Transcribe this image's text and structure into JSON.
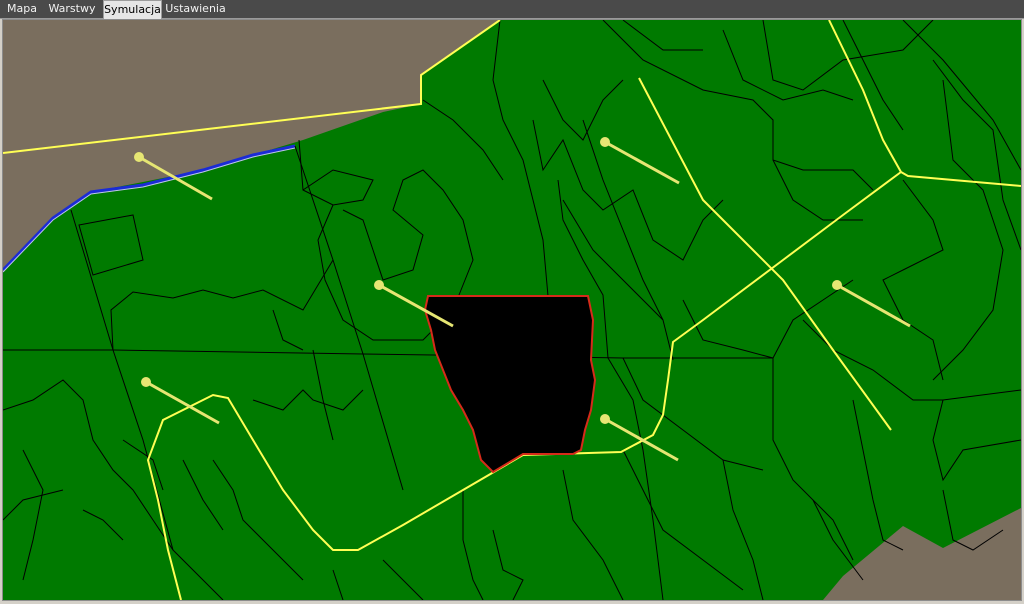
{
  "tabs": [
    {
      "label": "Mapa"
    },
    {
      "label": "Warstwy"
    },
    {
      "label": "Symulacja"
    },
    {
      "label": "Ustawienia"
    }
  ],
  "active_tab": "Symulacja",
  "colors": {
    "forest": "#007a00",
    "terrain": "#7a6e5e",
    "road": "#ffff55",
    "river": "#1a2bd6",
    "fire_area": "#000000",
    "fire_border": "#d62b1a",
    "marker": "#e6e673",
    "parcel_line": "#000000"
  },
  "map": {
    "marker_count": 6,
    "icons": [
      "wind-marker-icon",
      "burned-area",
      "road",
      "river"
    ]
  }
}
